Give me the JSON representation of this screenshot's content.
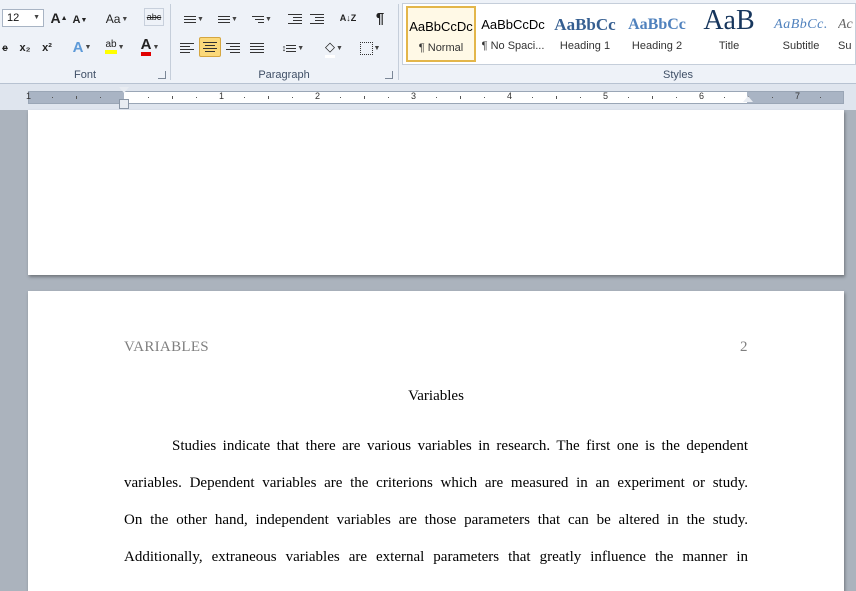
{
  "ribbon": {
    "font": {
      "size": "12",
      "grow": "A",
      "shrink": "A",
      "case": "Aa",
      "strike": "abc",
      "subscript": "x₂",
      "superscript": "x²",
      "effects": "A",
      "highlight": "ab",
      "color": "A",
      "group_label": "Font"
    },
    "paragraph": {
      "sort": "A↓Z",
      "pilcrow": "¶",
      "group_label": "Paragraph"
    },
    "styles": {
      "items": [
        {
          "preview": "AaBbCcDc",
          "name": "¶ Normal"
        },
        {
          "preview": "AaBbCcDc",
          "name": "¶ No Spaci..."
        },
        {
          "preview": "AaBbCc",
          "name": "Heading 1"
        },
        {
          "preview": "AaBbCc",
          "name": "Heading 2"
        },
        {
          "preview": "AaB",
          "name": "Title"
        },
        {
          "preview": "AaBbCc.",
          "name": "Subtitle"
        },
        {
          "preview": "Ac",
          "name": "Su"
        }
      ],
      "group_label": "Styles"
    },
    "accent_color": "#fbd97a"
  },
  "ruler": {
    "numbers": [
      "1",
      "1",
      "2",
      "3",
      "4",
      "5",
      "6",
      "7"
    ]
  },
  "document": {
    "header_left": "VARIABLES",
    "header_right": "2",
    "title": "Variables",
    "lines": [
      "Studies indicate that there are various variables in research. The first one is the dependent",
      "variables. Dependent variables are the criterions which are measured in an experiment or study.",
      "On the other hand, independent variables are those parameters that can be altered in the study.",
      "Additionally, extraneous variables are external parameters that greatly influence the manner in"
    ]
  }
}
